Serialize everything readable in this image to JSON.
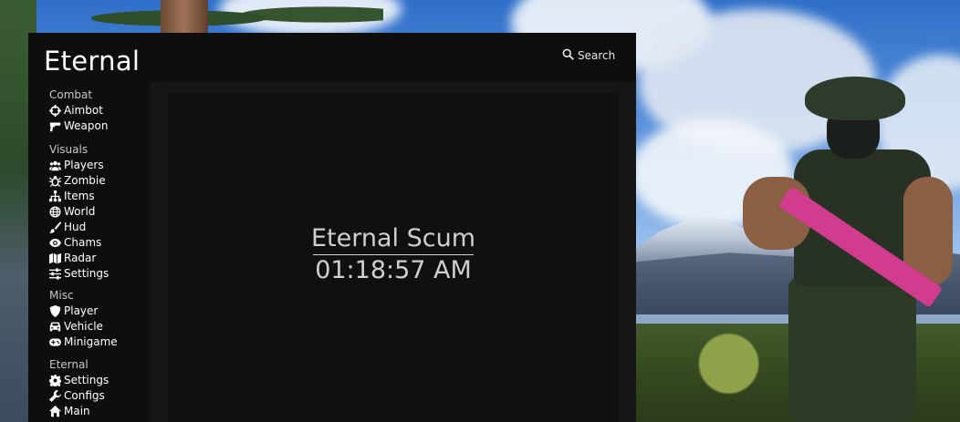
{
  "app": {
    "title": "Eternal",
    "search_label": "Search"
  },
  "sidebar": {
    "sections": [
      {
        "title": "Combat",
        "items": [
          {
            "label": "Aimbot",
            "icon": "crosshair-icon"
          },
          {
            "label": "Weapon",
            "icon": "pistol-icon"
          }
        ]
      },
      {
        "title": "Visuals",
        "items": [
          {
            "label": "Players",
            "icon": "users-icon"
          },
          {
            "label": "Zombie",
            "icon": "bug-icon"
          },
          {
            "label": "Items",
            "icon": "sitemap-icon"
          },
          {
            "label": "World",
            "icon": "globe-icon"
          },
          {
            "label": "Hud",
            "icon": "paintbrush-icon"
          },
          {
            "label": "Chams",
            "icon": "eye-icon"
          },
          {
            "label": "Radar",
            "icon": "map-icon"
          },
          {
            "label": "Settings",
            "icon": "sliders-icon"
          }
        ]
      },
      {
        "title": "Misc",
        "items": [
          {
            "label": "Player",
            "icon": "shield-icon"
          },
          {
            "label": "Vehicle",
            "icon": "car-icon"
          },
          {
            "label": "Minigame",
            "icon": "gamepad-icon"
          }
        ]
      },
      {
        "title": "Eternal",
        "items": [
          {
            "label": "Settings",
            "icon": "gear-icon"
          },
          {
            "label": "Configs",
            "icon": "wrench-icon"
          },
          {
            "label": "Main",
            "icon": "home-icon"
          }
        ]
      }
    ]
  },
  "main": {
    "welcome_name": "Eternal Scum",
    "clock": "01:18:57 AM"
  },
  "colors": {
    "panel_bg": "#121212",
    "sidebar_bg": "#0e0e0e",
    "text": "#ffffff",
    "muted_text": "#c7c7c7"
  }
}
